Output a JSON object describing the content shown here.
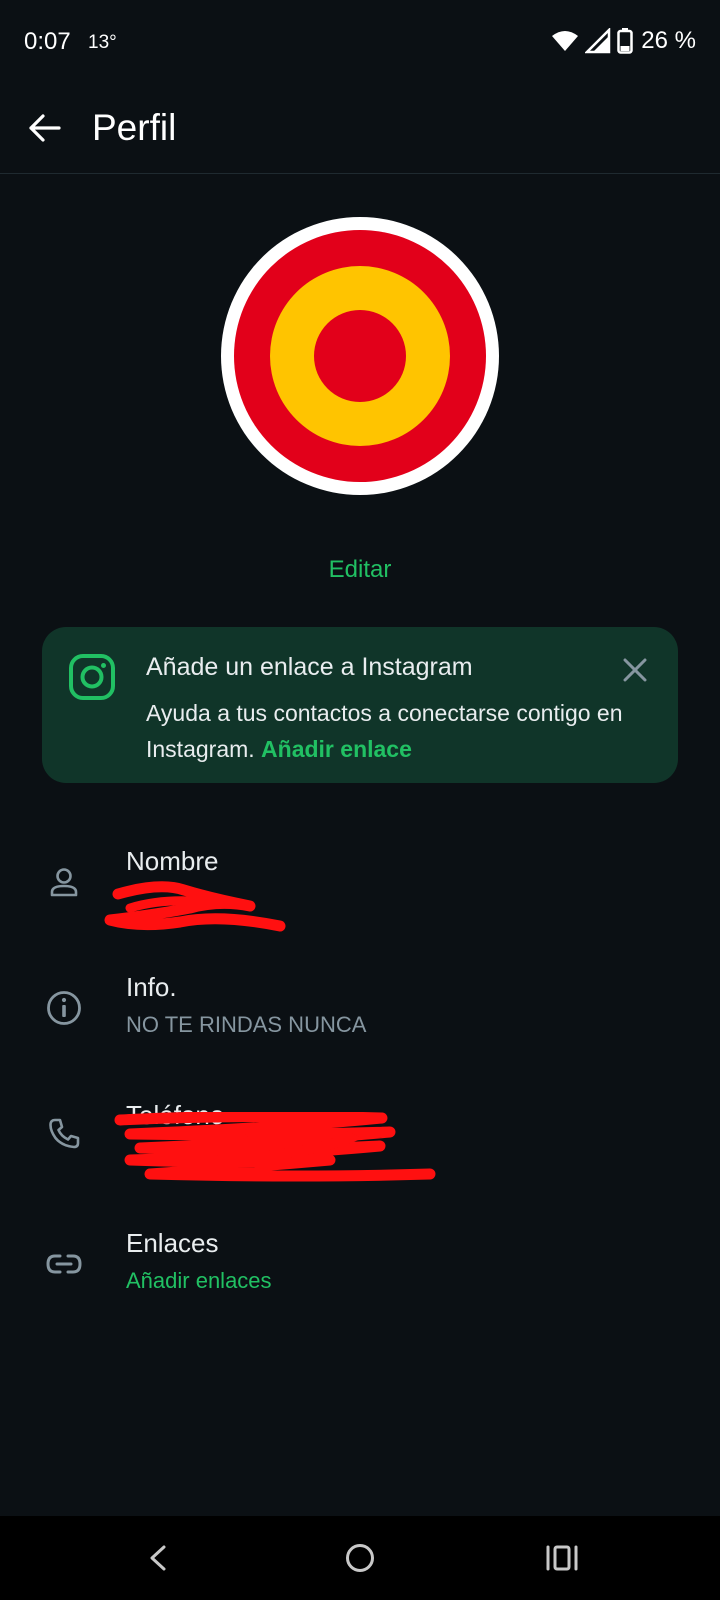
{
  "status_bar": {
    "time": "0:07",
    "temperature": "13°",
    "battery": "26 %"
  },
  "app_bar": {
    "title": "Perfil"
  },
  "avatar": {
    "edit_label": "Editar",
    "colors": {
      "outer_ring": "#ffffff",
      "red": "#e2001a",
      "yellow": "#ffc400"
    }
  },
  "instagram_banner": {
    "title": "Añade un enlace a Instagram",
    "body": "Ayuda a tus contactos a conectarse contigo en Instagram.",
    "link": "Añadir enlace"
  },
  "rows": {
    "name": {
      "label": "Nombre",
      "icon": "person-icon"
    },
    "info": {
      "label": "Info.",
      "value": "NO TE RINDAS NUNCA",
      "icon": "info-icon"
    },
    "phone": {
      "label": "Teléfono",
      "icon": "phone-icon"
    },
    "links": {
      "label": "Enlaces",
      "value": "Añadir enlaces",
      "icon": "link-icon"
    }
  },
  "theme": {
    "background": "#0b1014",
    "accent": "#21c063",
    "banner_bg": "#103529",
    "secondary_text": "#8696a0"
  }
}
